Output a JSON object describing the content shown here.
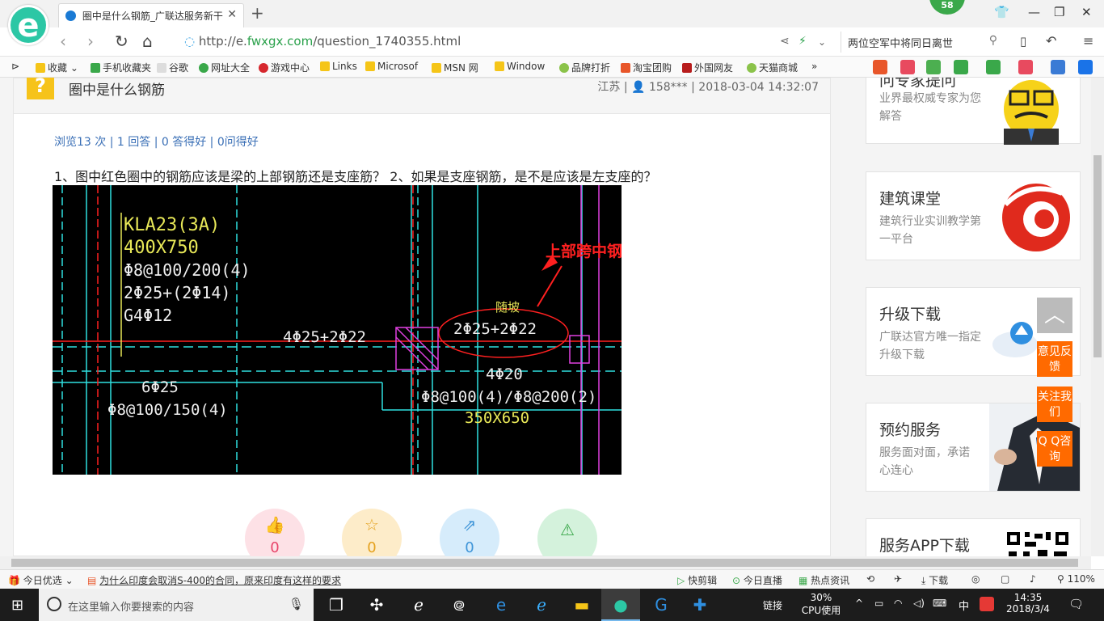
{
  "browser": {
    "tab_title": "圈中是什么钢筋_广联达服务新干",
    "badge_count": "58",
    "url_prefix": "http://e.",
    "url_domain": "fwxgx.com",
    "url_path": "/question_1740355.html",
    "search_text": "两位空军中将同日离世"
  },
  "bookmarks": [
    "收藏",
    "手机收藏夹",
    "谷歌",
    "网址大全",
    "游戏中心",
    "Links",
    "Microsof",
    "MSN 网",
    "Window",
    "品牌打折",
    "淘宝团购",
    "外国网友",
    "天猫商城"
  ],
  "question": {
    "title": "圈中是什么钢筋",
    "region": "江苏",
    "user": "158***",
    "datetime": "2018-03-04 14:32:07",
    "stats": "浏览13 次 | 1 回答 | 0 答得好 | 0问得好",
    "text": "1、图中红色圈中的钢筋应该是梁的上部钢筋还是支座筋？ 2、如果是支座钢筋，是不是应该是左支座的？",
    "actions": {
      "like": "0",
      "star": "0",
      "share": "0"
    }
  },
  "cad": {
    "beam_name": "KLA23(3A)",
    "beam_size": "400X750",
    "stirrup": "Φ8@100/200(4)",
    "top_bars": "2Φ25+(2Φ14)",
    "side_bars": "G4Φ12",
    "mid_top": "4Φ25+2Φ22",
    "circled": "2Φ25+2Φ22",
    "sui_po": "随坡",
    "annotation": "上部跨中钢筋",
    "left_bottom": "6Φ25",
    "left_stirrup": "Φ8@100/150(4)",
    "right_bottom": "4Φ20",
    "right_stirrup": "Φ8@100(4)/Φ8@200(2)",
    "right_size": "350X650"
  },
  "sidebar": {
    "ask_expert": {
      "title": "问专家提问",
      "desc": "业界最权威专家为您解答"
    },
    "classroom": {
      "title": "建筑课堂",
      "desc": "建筑行业实训教学第一平台"
    },
    "upgrade": {
      "title": "升级下载",
      "desc": "广联达官方唯一指定升级下载"
    },
    "booking": {
      "title": "预约服务",
      "desc": "服务面对面，承诺心连心"
    },
    "app": {
      "title": "服务APP下载"
    }
  },
  "float_buttons": {
    "feedback": "意见反馈",
    "follow": "关注我们",
    "qq": "Q Q咨询"
  },
  "statusbar": {
    "today": "今日优选",
    "news": "为什么印度会取消S-400的合同，原来印度有这样的要求",
    "kuaijianji": "快剪辑",
    "live": "今日直播",
    "hot": "热点资讯",
    "download": "下载",
    "zoom": "110%"
  },
  "taskbar": {
    "search_placeholder": "在这里输入你要搜索的内容",
    "link": "链接",
    "cpu_pct": "30%",
    "cpu_label": "CPU使用",
    "ime": "中",
    "time": "14:35",
    "date": "2018/3/4"
  }
}
